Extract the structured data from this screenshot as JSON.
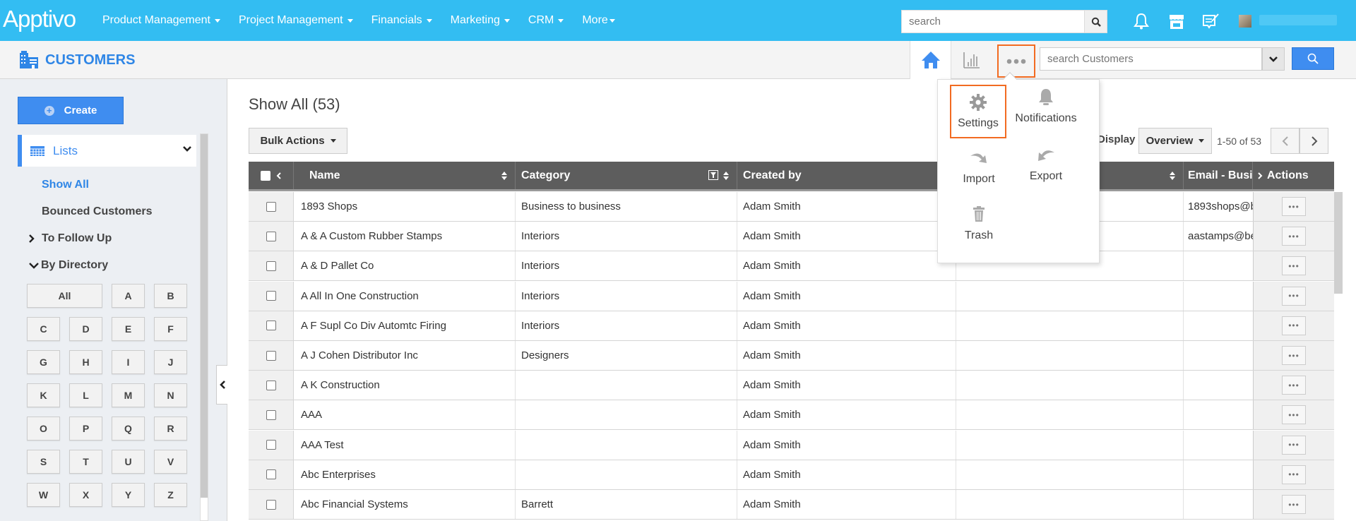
{
  "topbar": {
    "logo": "Apptivo",
    "nav": [
      {
        "label": "Product Management"
      },
      {
        "label": "Project Management"
      },
      {
        "label": "Financials"
      },
      {
        "label": "Marketing"
      },
      {
        "label": "CRM"
      },
      {
        "label": "More"
      }
    ],
    "search_placeholder": "search",
    "icons": [
      "bell-icon",
      "store-icon",
      "feedback-icon",
      "user-avatar"
    ]
  },
  "subbar": {
    "app_title": "CUSTOMERS",
    "search_placeholder": "search Customers"
  },
  "sidebar": {
    "create_label": "Create",
    "lists_label": "Lists",
    "items": [
      {
        "label": "Show All",
        "active": true
      },
      {
        "label": "Bounced Customers",
        "active": false
      },
      {
        "label": "To Follow Up",
        "expandable": true
      },
      {
        "label": "By Directory",
        "expanded": true
      }
    ],
    "directory": [
      "All",
      "A",
      "B",
      "C",
      "D",
      "E",
      "F",
      "G",
      "H",
      "I",
      "J",
      "K",
      "L",
      "M",
      "N",
      "O",
      "P",
      "Q",
      "R",
      "S",
      "T",
      "U",
      "V",
      "W",
      "X",
      "Y",
      "Z"
    ]
  },
  "main": {
    "title": "Show All (53)",
    "bulk_actions": "Bulk Actions",
    "display_label": "Display",
    "display_value": "Overview",
    "pager": "1-50 of 53",
    "columns": [
      "Name",
      "Category",
      "Created by",
      "",
      "Email - Busi",
      "Actions"
    ],
    "rows": [
      {
        "name": "1893 Shops",
        "category": "Business to business",
        "created_by": "Adam Smith",
        "email": "1893shops@b"
      },
      {
        "name": "A & A Custom Rubber Stamps",
        "category": "Interiors",
        "created_by": "Adam Smith",
        "email": "aastamps@be"
      },
      {
        "name": "A & D Pallet Co",
        "category": "Interiors",
        "created_by": "Adam Smith",
        "email": ""
      },
      {
        "name": "A All In One Construction",
        "category": "Interiors",
        "created_by": "Adam Smith",
        "email": ""
      },
      {
        "name": "A F Supl Co Div Automtc Firing",
        "category": "Interiors",
        "created_by": "Adam Smith",
        "email": ""
      },
      {
        "name": "A J Cohen Distributor Inc",
        "category": "Designers",
        "created_by": "Adam Smith",
        "email": ""
      },
      {
        "name": "A K Construction",
        "category": "",
        "created_by": "Adam Smith",
        "email": ""
      },
      {
        "name": "AAA",
        "category": "",
        "created_by": "Adam Smith",
        "email": ""
      },
      {
        "name": "AAA Test",
        "category": "",
        "created_by": "Adam Smith",
        "email": ""
      },
      {
        "name": "Abc Enterprises",
        "category": "",
        "created_by": "Adam Smith",
        "email": ""
      },
      {
        "name": "Abc Financial Systems",
        "category": "Barrett",
        "created_by": "Adam Smith",
        "email": ""
      }
    ],
    "row_action": "•••"
  },
  "popover": {
    "items": [
      {
        "label": "Settings",
        "icon": "gear-icon",
        "selected": true
      },
      {
        "label": "Notifications",
        "icon": "bell-icon"
      },
      {
        "label": "Import",
        "icon": "import-icon"
      },
      {
        "label": "Export",
        "icon": "export-icon"
      },
      {
        "label": "Trash",
        "icon": "trash-icon"
      }
    ]
  },
  "colors": {
    "topbar": "#33bdf2",
    "accent": "#3f8df0",
    "highlight": "#f26b21",
    "header": "#5d5d5d"
  }
}
